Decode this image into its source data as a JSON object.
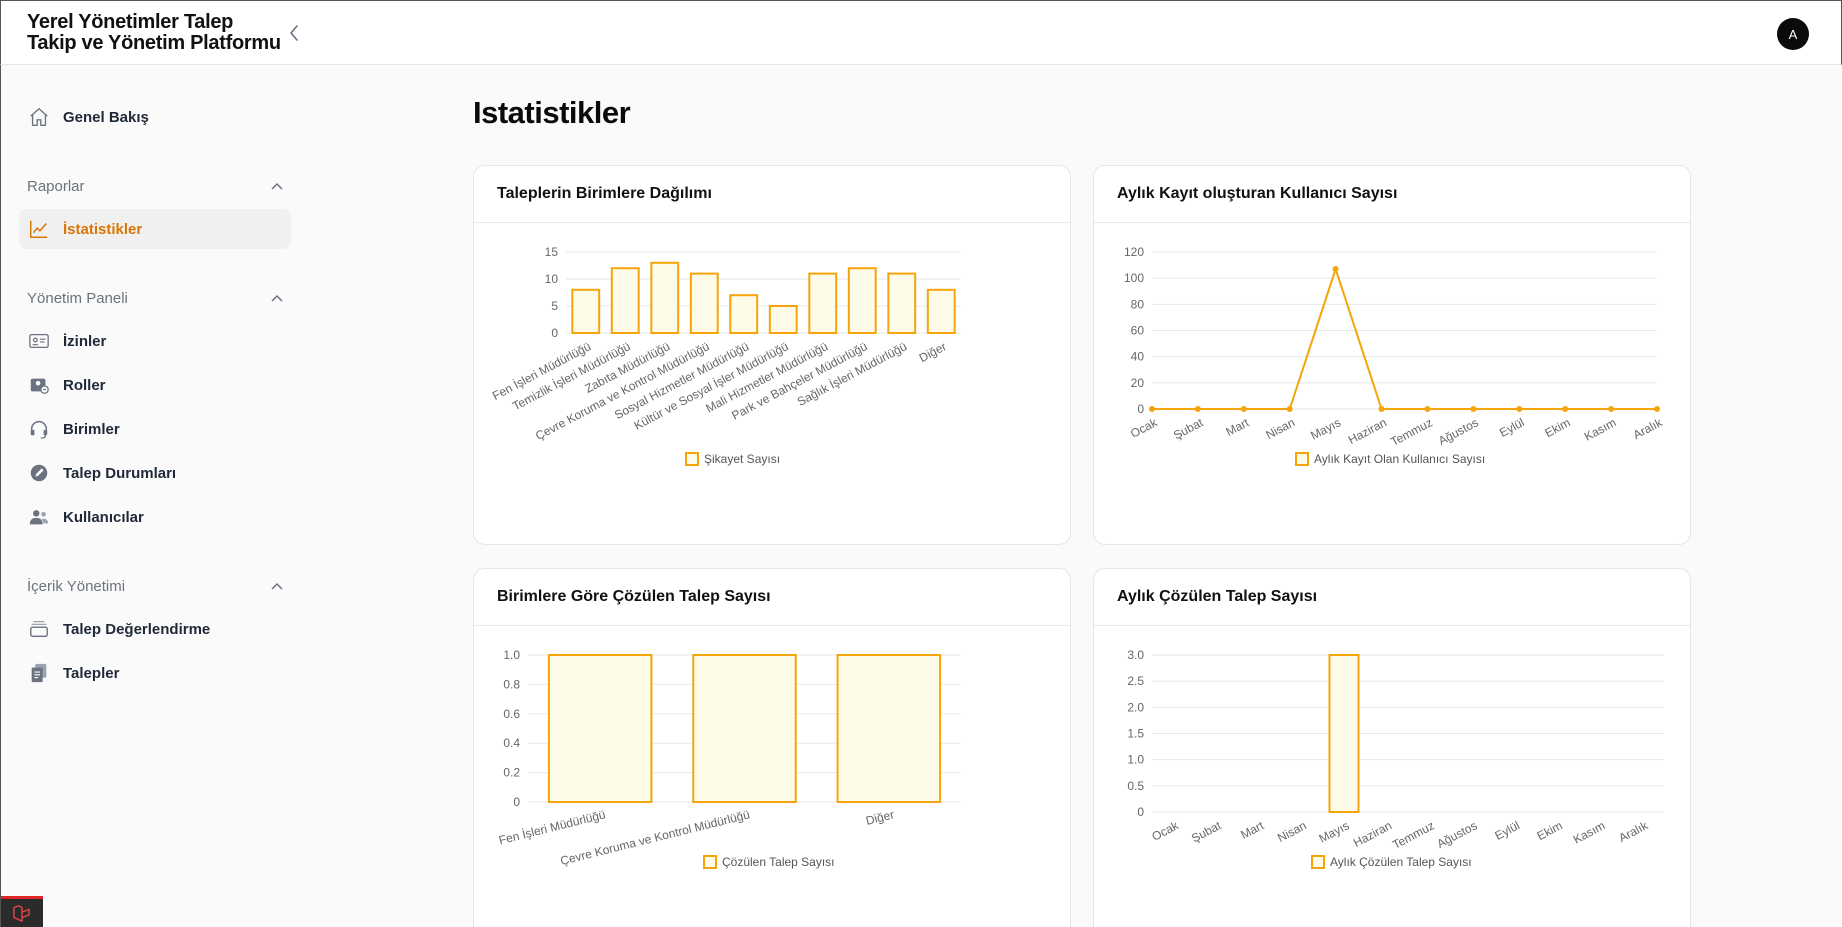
{
  "app": {
    "title_line1": "Yerel Yönetimler Talep",
    "title_line2": "Takip ve Yönetim Platformu",
    "avatar_initial": "A"
  },
  "sidebar": {
    "home": {
      "label": "Genel Bakış",
      "icon": "home-icon"
    },
    "groups": [
      {
        "label": "Raporlar",
        "items": [
          {
            "label": "İstatistikler",
            "icon": "chart-line-icon",
            "active": true
          }
        ]
      },
      {
        "label": "Yönetim Paneli",
        "items": [
          {
            "label": "İzinler",
            "icon": "id-card-icon"
          },
          {
            "label": "Roller",
            "icon": "user-roles-icon"
          },
          {
            "label": "Birimler",
            "icon": "headset-icon"
          },
          {
            "label": "Talep Durumları",
            "icon": "pen-circle-icon"
          },
          {
            "label": "Kullanıcılar",
            "icon": "users-icon"
          }
        ]
      },
      {
        "label": "İçerik Yönetimi",
        "items": [
          {
            "label": "Talep Değerlendirme",
            "icon": "inbox-stack-icon"
          },
          {
            "label": "Talepler",
            "icon": "documents-icon"
          }
        ]
      }
    ]
  },
  "page": {
    "title": "Istatistikler"
  },
  "colors": {
    "accent": "#d97706",
    "bar_stroke": "#f5a50a",
    "bar_fill": "#fefce8",
    "grid": "#e5e7eb"
  },
  "chart_data": [
    {
      "type": "bar",
      "title": "Taleplerin Birimlere Dağılımı",
      "categories": [
        "Fen İşleri Müdürlüğü",
        "Temizlik İşleri Müdürlüğü",
        "Zabıta Müdürlüğü",
        "Çevre Koruma ve Kontrol Müdürlüğü",
        "Sosyal Hizmetler Müdürlüğü",
        "Kültür ve Sosyal İşler Müdürlüğü",
        "Mali Hizmetler Müdürlüğü",
        "Park ve Bahçeler Müdürlüğü",
        "Sağlık İşleri Müdürlüğü",
        "Diğer"
      ],
      "series": [
        {
          "name": "Şikayet Sayısı",
          "values": [
            8,
            12,
            13,
            11,
            7,
            5,
            11,
            12,
            11,
            8
          ]
        }
      ],
      "yticks": [
        "0",
        "5",
        "10",
        "15"
      ],
      "ylim": [
        0,
        15
      ]
    },
    {
      "type": "line",
      "title": "Aylık Kayıt oluşturan Kullanıcı Sayısı",
      "categories": [
        "Ocak",
        "Şubat",
        "Mart",
        "Nisan",
        "Mayıs",
        "Haziran",
        "Temmuz",
        "Ağustos",
        "Eylül",
        "Ekim",
        "Kasım",
        "Aralık"
      ],
      "series": [
        {
          "name": "Aylık Kayıt Olan Kullanıcı Sayısı",
          "values": [
            0,
            0,
            0,
            0,
            107,
            0,
            0,
            0,
            0,
            0,
            0,
            0
          ]
        }
      ],
      "yticks": [
        "0",
        "20",
        "40",
        "60",
        "80",
        "100",
        "120"
      ],
      "ylim": [
        0,
        120
      ]
    },
    {
      "type": "bar",
      "title": "Birimlere Göre Çözülen Talep Sayısı",
      "categories": [
        "Fen İşleri Müdürlüğü",
        "Çevre Koruma ve Kontrol Müdürlüğü",
        "Diğer"
      ],
      "series": [
        {
          "name": "Çözülen Talep Sayısı",
          "values": [
            1,
            1,
            1
          ]
        }
      ],
      "yticks": [
        "0",
        "0.2",
        "0.4",
        "0.6",
        "0.8",
        "1.0"
      ],
      "ylim": [
        0,
        1
      ]
    },
    {
      "type": "bar",
      "title": "Aylık Çözülen Talep Sayısı",
      "categories": [
        "Ocak",
        "Şubat",
        "Mart",
        "Nisan",
        "Mayıs",
        "Haziran",
        "Temmuz",
        "Ağustos",
        "Eylül",
        "Ekim",
        "Kasım",
        "Aralık"
      ],
      "series": [
        {
          "name": "Aylık Çözülen Talep Sayısı",
          "values": [
            0,
            0,
            0,
            0,
            3,
            0,
            0,
            0,
            0,
            0,
            0,
            0
          ]
        }
      ],
      "yticks": [
        "0",
        "0.5",
        "1.0",
        "1.5",
        "2.0",
        "2.5",
        "3.0"
      ],
      "ylim": [
        0,
        3
      ]
    }
  ]
}
